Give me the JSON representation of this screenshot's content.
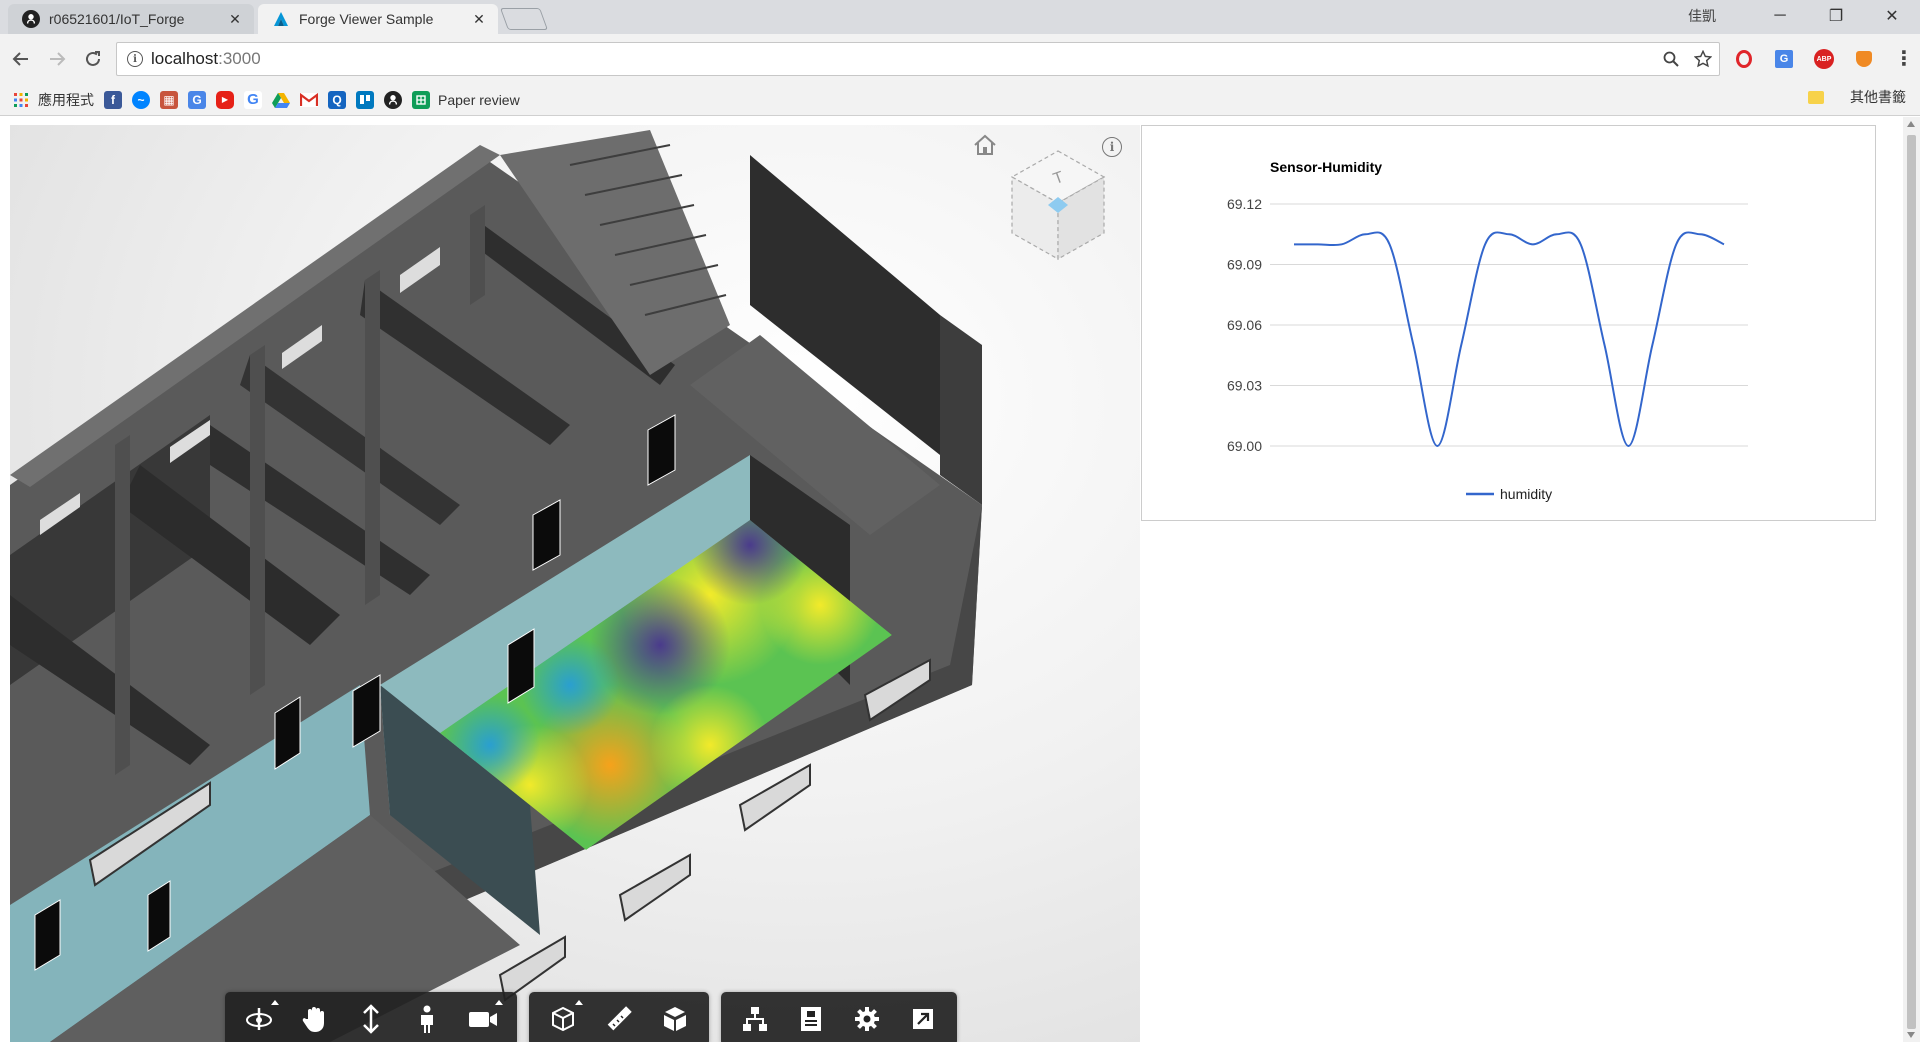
{
  "tabs": [
    {
      "title": "r06521601/IoT_Forge",
      "favicon": "github-icon",
      "active": false
    },
    {
      "title": "Forge Viewer Sample",
      "favicon": "autodesk-icon",
      "active": true
    }
  ],
  "window": {
    "profile_name": "佳凱",
    "minimize": "─",
    "restore": "❐",
    "close": "✕"
  },
  "address_bar": {
    "host": "localhost",
    "port": ":3000",
    "info": "i"
  },
  "bookmarks": [
    {
      "icon": "apps-icon",
      "label": "應用程式"
    },
    {
      "icon": "facebook-icon",
      "label": ""
    },
    {
      "icon": "messenger-icon",
      "label": ""
    },
    {
      "icon": "university-icon",
      "label": ""
    },
    {
      "icon": "translate-icon",
      "label": ""
    },
    {
      "icon": "youtube-icon",
      "label": ""
    },
    {
      "icon": "google-icon",
      "label": ""
    },
    {
      "icon": "drive-icon",
      "label": ""
    },
    {
      "icon": "gmail-icon",
      "label": ""
    },
    {
      "icon": "q-icon",
      "label": ""
    },
    {
      "icon": "trello-icon",
      "label": ""
    },
    {
      "icon": "github-icon",
      "label": ""
    },
    {
      "icon": "sheets-icon",
      "label": "Paper review"
    }
  ],
  "other_bookmarks": "其他書籤",
  "viewer": {
    "info": "i",
    "viewcube_face": "T"
  },
  "chart_data": {
    "type": "line",
    "title": "Sensor-Humidity",
    "yticks": [
      "69.12",
      "69.09",
      "69.06",
      "69.03",
      "69.00"
    ],
    "ylim": [
      69.0,
      69.12
    ],
    "series": [
      {
        "name": "humidity",
        "color": "#3366cc",
        "values": [
          69.1,
          69.1,
          69.1,
          69.105,
          69.1,
          69.05,
          69.0,
          69.05,
          69.1,
          69.105,
          69.1,
          69.105,
          69.1,
          69.05,
          69.0,
          69.05,
          69.1,
          69.105,
          69.1
        ]
      }
    ],
    "grid": true,
    "legend_position": "bottom"
  }
}
